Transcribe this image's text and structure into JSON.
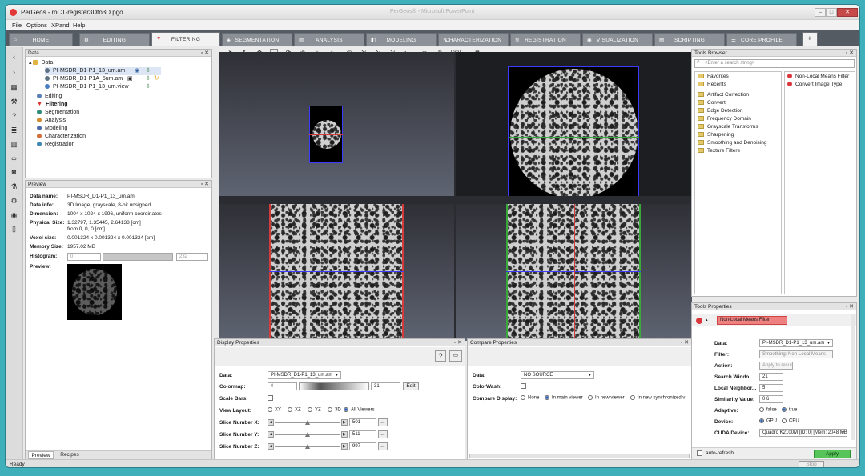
{
  "window": {
    "title": "PerGeos - mCT-register3Dto3D.pgo",
    "center_title": "PerGeos® - Microsoft PowerPoint",
    "status": "Ready",
    "stop_label": "Stop"
  },
  "menu": [
    "File",
    "Options",
    "XPand",
    "Help"
  ],
  "tabs": [
    {
      "label": "HOME",
      "icon": "home-icon",
      "active": false
    },
    {
      "label": "EDITING",
      "icon": "gears-icon",
      "active": false
    },
    {
      "label": "FILTERING",
      "icon": "filter-icon",
      "active": true
    },
    {
      "label": "SEGMENTATION",
      "icon": "segmentation-icon",
      "active": false
    },
    {
      "label": "ANALYSIS",
      "icon": "chart-icon",
      "active": false
    },
    {
      "label": "MODELING",
      "icon": "cube-icon",
      "active": false
    },
    {
      "label": "CHARACTERIZATION",
      "icon": "curve-icon",
      "active": false
    },
    {
      "label": "REGISTRATION",
      "icon": "layers-icon",
      "active": false
    },
    {
      "label": "VISUALIZATION",
      "icon": "eye-icon",
      "active": false
    },
    {
      "label": "SCRIPTING",
      "icon": "script-icon",
      "active": false
    },
    {
      "label": "CORE PROFILE",
      "icon": "profile-icon",
      "active": false
    },
    {
      "label": "+",
      "icon": "add-icon",
      "active": false
    }
  ],
  "data_panel": {
    "title": "Data",
    "root": "Data",
    "items": [
      "PI-MSDR_D1-P1_13_um.am",
      "PI-MSDR_D1-P1A_5um.am",
      "PI-MSDR_D1-P1_13_um.view"
    ],
    "categories": [
      "Editing",
      "Filtering",
      "Segmentation",
      "Analysis",
      "Modeling",
      "Characterization",
      "Registration"
    ]
  },
  "preview_panel": {
    "title": "Preview",
    "data_name_label": "Data name:",
    "data_name": "PI-MSDR_D1-P1_13_um.am",
    "data_info_label": "Data info:",
    "data_info": "3D Image, grayscale, 8-bit unsigned",
    "dimension_label": "Dimension:",
    "dimension": "1004 x 1024 x 1996, uniform coordinates",
    "physical_size_label": "Physical Size:",
    "physical_size": "1.32797, 1.35445, 2.64138 [cm]",
    "physical_from": "from 0, 0, 0 [cm]",
    "voxel_size_label": "Voxel size:",
    "voxel_size": "0.001324 x 0.001324 x 0.001324 [cm]",
    "memory_size_label": "Memory Size:",
    "memory_size": "1957.02 MB",
    "histogram_label": "Histogram:",
    "hist_min": "0",
    "hist_max": "232",
    "preview_label": "Preview:",
    "tabs": [
      "Preview",
      "Recipes"
    ]
  },
  "display_props": {
    "title": "Display Properties",
    "data_label": "Data:",
    "data_value": "PI-MSDR_D1-P1_13_um.am",
    "colormap_label": "Colormap:",
    "colormap_min": "0",
    "colormap_max": "31",
    "edit_label": "Edit",
    "scalebars_label": "Scale Bars:",
    "viewlayout_label": "View Layout:",
    "layouts": [
      {
        "label": "XY",
        "on": false
      },
      {
        "label": "XZ",
        "on": false
      },
      {
        "label": "YZ",
        "on": false
      },
      {
        "label": "3D",
        "on": false
      },
      {
        "label": "All Viewers",
        "on": true
      }
    ],
    "slices": [
      {
        "label": "Slice Number X:",
        "value": "501",
        "level": 0.5
      },
      {
        "label": "Slice Number Y:",
        "value": "511",
        "level": 0.5
      },
      {
        "label": "Slice Number Z:",
        "value": "997",
        "level": 0.5
      }
    ],
    "dots": "..."
  },
  "compare_props": {
    "title": "Compare Properties",
    "data_label": "Data:",
    "data_value": "NO SOURCE",
    "colorwash_label": "ColorWash:",
    "compare_label": "Compare Display:",
    "options": [
      {
        "label": "None",
        "on": false
      },
      {
        "label": "In main viewer",
        "on": true
      },
      {
        "label": "In new viewer",
        "on": false
      },
      {
        "label": "In new synchronized v",
        "on": false
      }
    ]
  },
  "tools_browser": {
    "title": "Tools Browser",
    "search_placeholder": "<Enter a search string>",
    "left": [
      "Favorites",
      "Recents",
      "Artifact Correction",
      "Convert",
      "Edge Detection",
      "Frequency Domain",
      "Grayscale Transforms",
      "Sharpening",
      "Smoothing and Denoising",
      "Texture Filters"
    ],
    "right": [
      "Non-Local Means Filter",
      "Convert Image Type"
    ]
  },
  "tools_props": {
    "title": "Tools Properties",
    "header": "Non-Local Means Filter",
    "rows": [
      {
        "label": "Data:",
        "value": "PI-MSDR_D1-P1_13_um.am"
      },
      {
        "label": "Filter:",
        "value": "Smoothing: Non-Local Means"
      },
      {
        "label": "Action:",
        "value": "Apply to result"
      },
      {
        "label": "Search Windo...",
        "value": "21"
      },
      {
        "label": "Local Neighbor...",
        "value": "5"
      },
      {
        "label": "Similarity Value:",
        "value": "0.6"
      }
    ],
    "adaptive_label": "Adaptive:",
    "adaptive_false": "false",
    "adaptive_true": "true",
    "device_label": "Device:",
    "device_gpu": "GPU",
    "device_cpu": "CPU",
    "cuda_label": "CUDA Device:",
    "cuda_value": "Quadro K2100M [ID: 0] [Mem: 2048 MB]",
    "auto_refresh": "auto-refresh",
    "apply": "Apply"
  },
  "viewer": {
    "zoom_mode": "[cm]"
  }
}
